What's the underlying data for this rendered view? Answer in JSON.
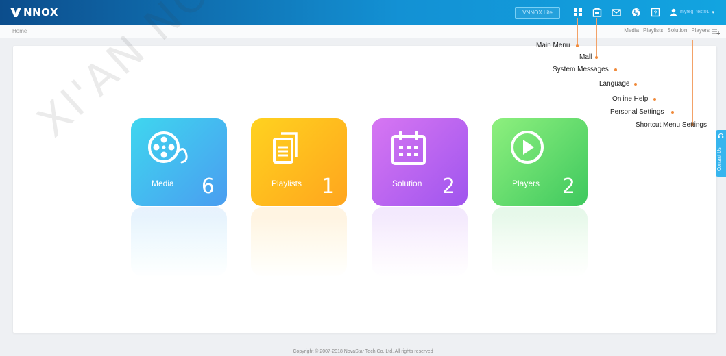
{
  "app": {
    "logo_text": "NNOX"
  },
  "header": {
    "lite_button": "VNNOX Lite",
    "icons": [
      "main-menu-icon",
      "mall-icon",
      "mail-icon",
      "globe-icon",
      "help-icon",
      "user-icon"
    ],
    "user_name": "myreg_test01",
    "colors": {
      "bar_start": "#0c4d8c",
      "bar_end": "#12a4e0"
    }
  },
  "breadcrumb": {
    "current": "Home"
  },
  "quick_links": [
    "Media",
    "Playlists",
    "Solution",
    "Players"
  ],
  "tiles": [
    {
      "label": "Media",
      "count": "6",
      "color_start": "#3fd6ef",
      "color_end": "#4a9df0"
    },
    {
      "label": "Playlists",
      "count": "1",
      "color_start": "#ffd21f",
      "color_end": "#ffa51e"
    },
    {
      "label": "Solution",
      "count": "2",
      "color_start": "#d776f2",
      "color_end": "#9f55ee"
    },
    {
      "label": "Players",
      "count": "2",
      "color_start": "#8ef07e",
      "color_end": "#3ec85e"
    }
  ],
  "contact": {
    "label": "Contact Us"
  },
  "footer": {
    "copyright": "Copyright © 2007-2018 NovaStar Tech Co.,Ltd. All rights reserved"
  },
  "watermark": "XI'AN NOVASTAR",
  "callouts": {
    "main_menu": "Main Menu",
    "mall": "Mall",
    "system_messages": "System Messages",
    "language": "Language",
    "online_help": "Online Help",
    "personal_settings": "Personal Settings",
    "shortcut_menu_settings": "Shortcut Menu Settings"
  }
}
